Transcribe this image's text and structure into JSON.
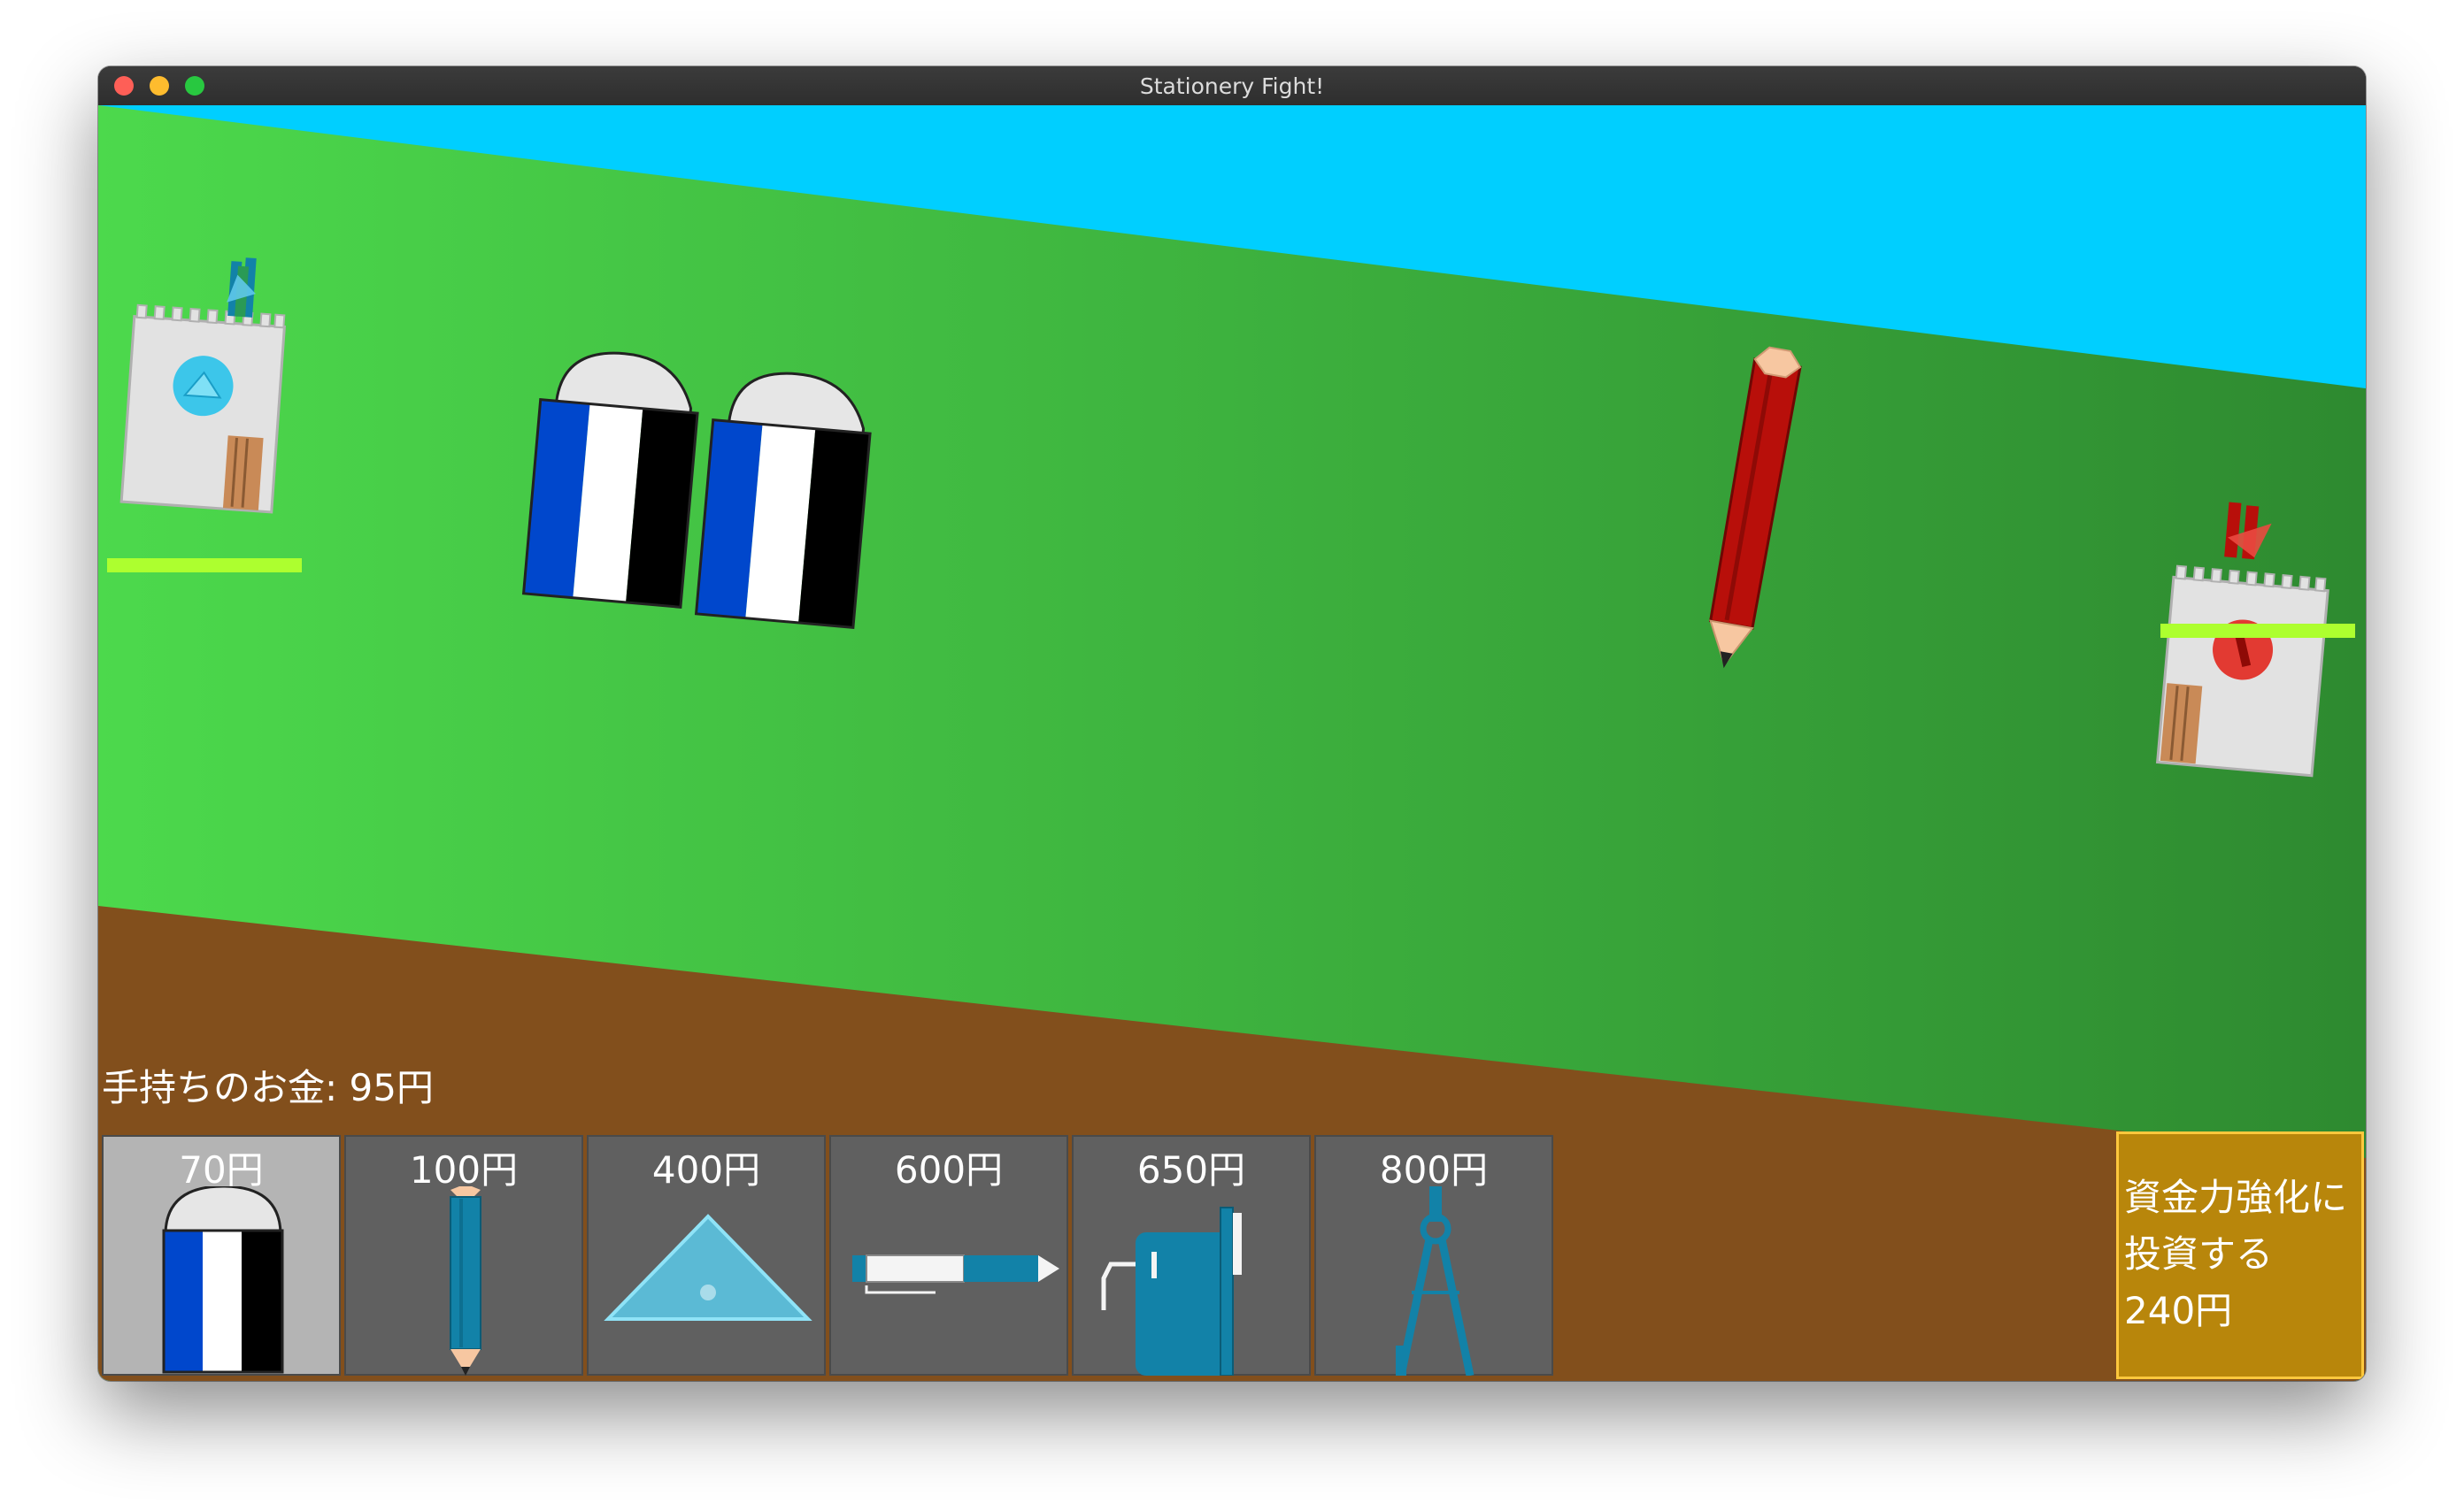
{
  "window": {
    "title": "Stationery Fight!"
  },
  "colors": {
    "sky": "#00cfff",
    "grass_left": "#4cd94c",
    "grass_right": "#2e8a30",
    "dirt": "#824f1c",
    "hp_bar": "#adff2f",
    "shop_slot": "#606060",
    "shop_slot_selected": "#b4b4b4",
    "invest_button": "#b8860b",
    "invest_border": "#ffc83d",
    "player_unit": "#1282a8",
    "enemy_unit": "#b80f0a"
  },
  "hud": {
    "money_text": "手持ちのお金: 95円"
  },
  "shop": {
    "items": [
      {
        "price": "70円",
        "icon": "eraser-icon",
        "selected": true
      },
      {
        "price": "100円",
        "icon": "pencil-icon",
        "selected": false
      },
      {
        "price": "400円",
        "icon": "set-square-icon",
        "selected": false
      },
      {
        "price": "600円",
        "icon": "pen-icon",
        "selected": false
      },
      {
        "price": "650円",
        "icon": "pencil-sharpener-icon",
        "selected": false
      },
      {
        "price": "800円",
        "icon": "compass-icon",
        "selected": false
      }
    ]
  },
  "invest": {
    "line1": "資金力強化に",
    "line2": "投資する",
    "line3": "240円"
  },
  "battlefield": {
    "player_base": {
      "icon": "player-castle-icon",
      "hp": 1.0
    },
    "enemy_base": {
      "icon": "enemy-castle-icon",
      "hp": 1.0
    },
    "units": [
      {
        "side": "player",
        "type": "eraser"
      },
      {
        "side": "player",
        "type": "eraser"
      },
      {
        "side": "enemy",
        "type": "pencil"
      }
    ]
  }
}
